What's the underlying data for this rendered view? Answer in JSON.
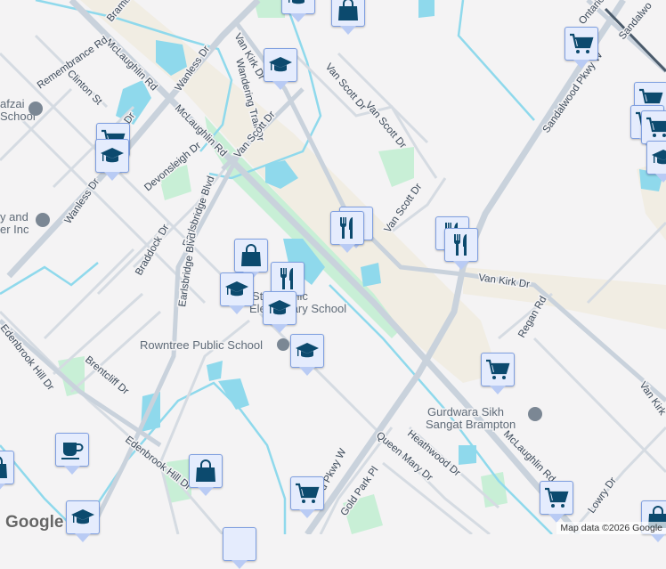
{
  "map": {
    "streets": {
      "mclaughlin_1": "McLaughlin Rd",
      "mclaughlin_2": "McLaughlin Rd",
      "mclaughlin_3": "McLaughlin Rd",
      "wanless_1": "Wanless Dr",
      "wanless_2": "Wanless Dr",
      "wanless_3": "Wanless Dr",
      "remembrance": "Remembrance Rd",
      "clinton": "Clinton St",
      "bramtr": "Bramtr",
      "van_kirk_1": "Van Kirk Dr",
      "van_kirk_2": "Van Kirk Dr",
      "van_kirk_3": "Van Kirk",
      "wandering": "Wandering Trail Dr",
      "van_scott_1": "Van Scott Dr",
      "van_scott_2": "Van Scott Dr",
      "van_scott_3": "Van Scott Dr",
      "van_scott_4": "Van Scott Dr",
      "devonsleigh": "Devonsleigh Dr",
      "earlsbridge_1": "Earlsbridge Blvd",
      "earlsbridge_2": "Earlsbridge Blvd",
      "braddock": "Braddock Dr",
      "brentcliff": "Brentcliff Dr",
      "edenbrook_1": "Edenbrook Hill Dr",
      "edenbrook_2": "Edenbrook Hill Dr",
      "regan": "Regan Rd",
      "queen_mary": "Queen Mary Dr",
      "heathwood": "Heathwood Dr",
      "gold_park": "Gold Park Pl",
      "lowry": "Lowry Dr",
      "sandalwood_1": "Sandalwood Pkwy W",
      "sandalwood_2": "wood Pkwy W",
      "sandalwood_3": "Sandalwo",
      "ontario": "Ontario St"
    },
    "pois": {
      "rowntree": "Rowntree Public School",
      "gurdwara_1": "Gurdwara Sikh",
      "gurdwara_2": "Sangat Brampton",
      "catholic_1": "St Catholic",
      "catholic_2": "Elementary School",
      "afzai_1": "afzai",
      "afzai_2": "School",
      "inc_1": "y and",
      "inc_2": "er Inc"
    },
    "attribution": "Map data ©2026 Google",
    "logo": "Google"
  }
}
